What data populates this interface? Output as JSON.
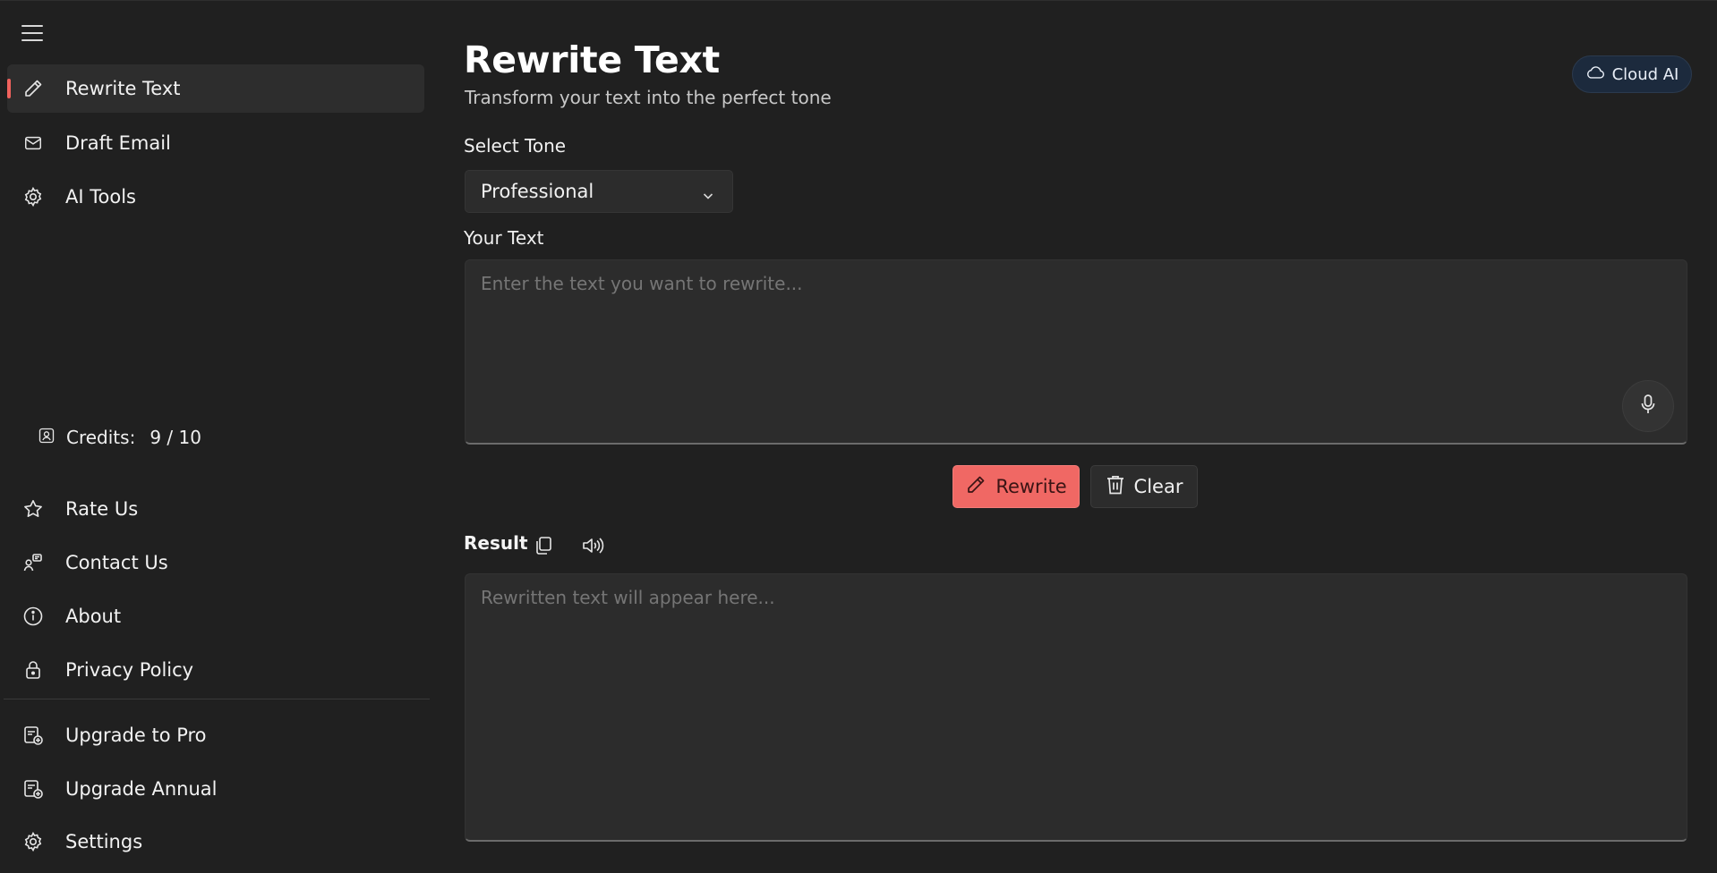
{
  "sidebar": {
    "top_items": [
      {
        "label": "Rewrite Text",
        "icon": "pencil-icon",
        "active": true
      },
      {
        "label": "Draft Email",
        "icon": "mail-icon",
        "active": false
      },
      {
        "label": "AI Tools",
        "icon": "gear-icon",
        "active": false
      }
    ],
    "credits": {
      "label": "Credits:",
      "value": "9 / 10"
    },
    "bottom_items": [
      {
        "label": "Rate Us",
        "icon": "star-icon"
      },
      {
        "label": "Contact Us",
        "icon": "contact-icon"
      },
      {
        "label": "About",
        "icon": "info-icon"
      },
      {
        "label": "Privacy Policy",
        "icon": "lock-icon"
      },
      {
        "label": "Upgrade to Pro",
        "icon": "upgrade-icon"
      },
      {
        "label": "Upgrade Annual",
        "icon": "upgrade-icon"
      },
      {
        "label": "Settings",
        "icon": "gear-icon"
      }
    ]
  },
  "main": {
    "title": "Rewrite Text",
    "subtitle": "Transform your text into the perfect tone",
    "cloud_button": "Cloud AI",
    "tone_label": "Select Tone",
    "tone_selected": "Professional",
    "input_label": "Your Text",
    "input_placeholder": "Enter the text you want to rewrite...",
    "input_value": "",
    "rewrite_button": "Rewrite",
    "clear_button": "Clear",
    "result_label": "Result",
    "result_placeholder": "Rewritten text will appear here..."
  },
  "colors": {
    "background": "#202020",
    "accent": "#f06864",
    "panel": "#2c2c2c",
    "cloud_badge": "#1c2a3d"
  }
}
